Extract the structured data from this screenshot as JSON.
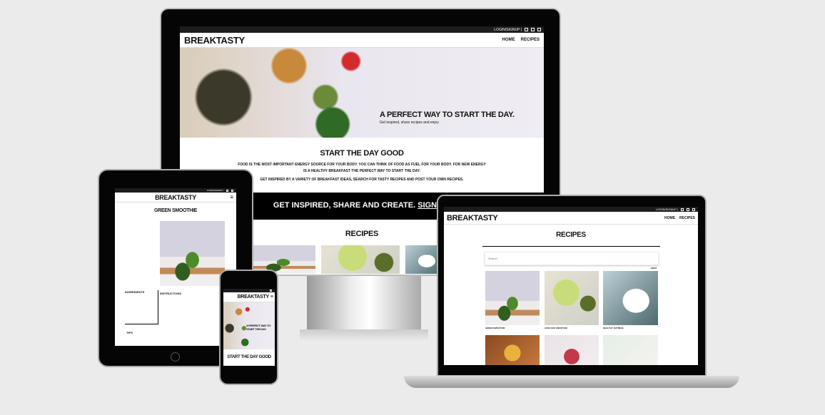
{
  "brand": "BREAKTASTY",
  "topbar": {
    "login": "LOGIN/SIGNUP |"
  },
  "nav": {
    "home": "HOME",
    "recipes": "RECIPES"
  },
  "hero": {
    "title": "A PERFECT WAY TO START THE DAY.",
    "subtitle": "Get inspired, share recipes and enjoy"
  },
  "intro": {
    "title": "START THE DAY GOOD",
    "p1": "FOOD IS THE MOST IMPORTANT ENERGY SOURCE FOR YOUR BODY. YOU CAN THINK OF FOOD AS FUEL FOR YOUR BODY. FOR NEW ENERGY IS A HEALTHY BREAKFAST THE PERFECT WAY TO START THE DAY.",
    "p2": "GET INSPIRED BY A VARIETY OF BREAKFAST IDEAS, SEARCH FOR TASTY RECIPES AND POST YOUR OWN RECIPES."
  },
  "cta": {
    "text": "GET INSPIRED, SHARE AND CREATE.",
    "link": "SIGNUP!"
  },
  "recipes": {
    "title": "RECIPES",
    "search_placeholder": "Search",
    "sort": "SORT",
    "cards": [
      "GREEN SMOOTHIE",
      "AVOCADO SMOOTHIE",
      "HEALTHY OATMEAL"
    ]
  },
  "tablet": {
    "recipe_title": "GREEN SMOOTHIE",
    "ingredients": "INGREDIENTS",
    "instructions": "INSTRUCTIONS",
    "tips": "TIPS"
  }
}
